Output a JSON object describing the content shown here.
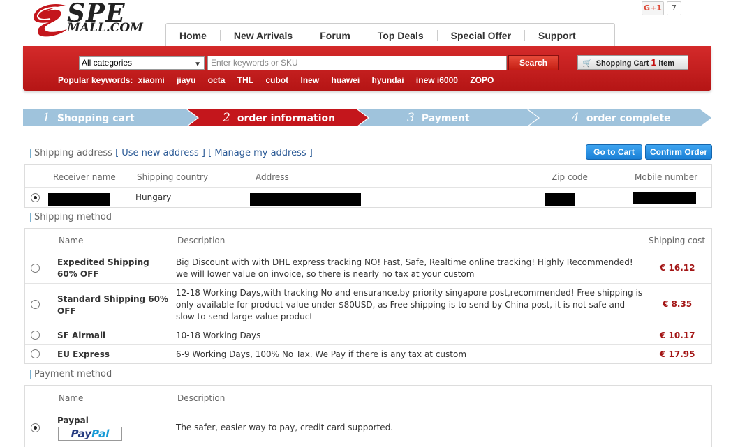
{
  "logo": {
    "line1": "SPE",
    "line2": "MALL.COM"
  },
  "gplus": {
    "label": "G+1",
    "count": "7"
  },
  "nav": [
    "Home",
    "New Arrivals",
    "Forum",
    "Top Deals",
    "Special Offer",
    "Support"
  ],
  "search": {
    "category": "All categories",
    "placeholder": "Enter keywords or SKU",
    "button": "Search"
  },
  "cart": {
    "label": "Shopping Cart",
    "count": "1",
    "unit": "item"
  },
  "popular": {
    "label": "Popular keywords:",
    "keywords": [
      "xiaomi",
      "jiayu",
      "octa",
      "THL",
      "cubot",
      "Inew",
      "huawei",
      "hyundai",
      "inew i6000",
      "ZOPO"
    ]
  },
  "steps": [
    {
      "num": "1",
      "label": "Shopping cart",
      "active": false
    },
    {
      "num": "2",
      "label": "order information",
      "active": true
    },
    {
      "num": "3",
      "label": "Payment",
      "active": false
    },
    {
      "num": "4",
      "label": "order complete",
      "active": false
    }
  ],
  "colors": {
    "step_active": "#c4161c",
    "step_inactive": "#9fc3dc",
    "brand_red": "#c4161c",
    "price": "#a31515"
  },
  "shipping_address": {
    "title": "Shipping address",
    "use_new": "[ Use new address ]",
    "manage": "[ Manage my address ]",
    "buttons": {
      "go_to_cart": "Go to Cart",
      "confirm_order": "Confirm Order"
    },
    "headers": [
      "Receiver name",
      "Shipping country",
      "Address",
      "Zip code",
      "Mobile number"
    ],
    "rows": [
      {
        "country": "Hungary",
        "selected": true
      }
    ]
  },
  "shipping_method": {
    "title": "Shipping method",
    "headers": [
      "Name",
      "Description",
      "Shipping cost"
    ],
    "rows": [
      {
        "name": "Expedited Shipping 60% OFF",
        "desc": "Big Discount with with DHL express tracking NO! Fast, Safe, Realtime online tracking! Highly Recommended! we will lower value on invoice, so there is nearly no tax at your custom",
        "cost": "€ 16.12",
        "selected": false
      },
      {
        "name": "Standard Shipping 60% OFF",
        "desc": "12-18 Working Days,with tracking No and ensurance.by priority singapore post,recommended! Free shipping is only available for product value under $80USD, as Free shipping is to send by China post, it is not safe and slow to send large value product",
        "cost": "€ 8.35",
        "selected": false
      },
      {
        "name": "SF Airmail",
        "desc": "10-18 Working Days",
        "cost": "€ 10.17",
        "selected": false
      },
      {
        "name": "EU Express",
        "desc": "6-9 Working Days, 100% No Tax. We Pay if there is any tax at custom",
        "cost": "€ 17.95",
        "selected": false
      }
    ]
  },
  "payment_method": {
    "title": "Payment method",
    "headers": [
      "Name",
      "Description"
    ],
    "rows": [
      {
        "name": "Paypal",
        "logo_text": "PayPal",
        "desc": "The safer, easier way to pay, credit card supported.",
        "selected": true
      }
    ]
  }
}
